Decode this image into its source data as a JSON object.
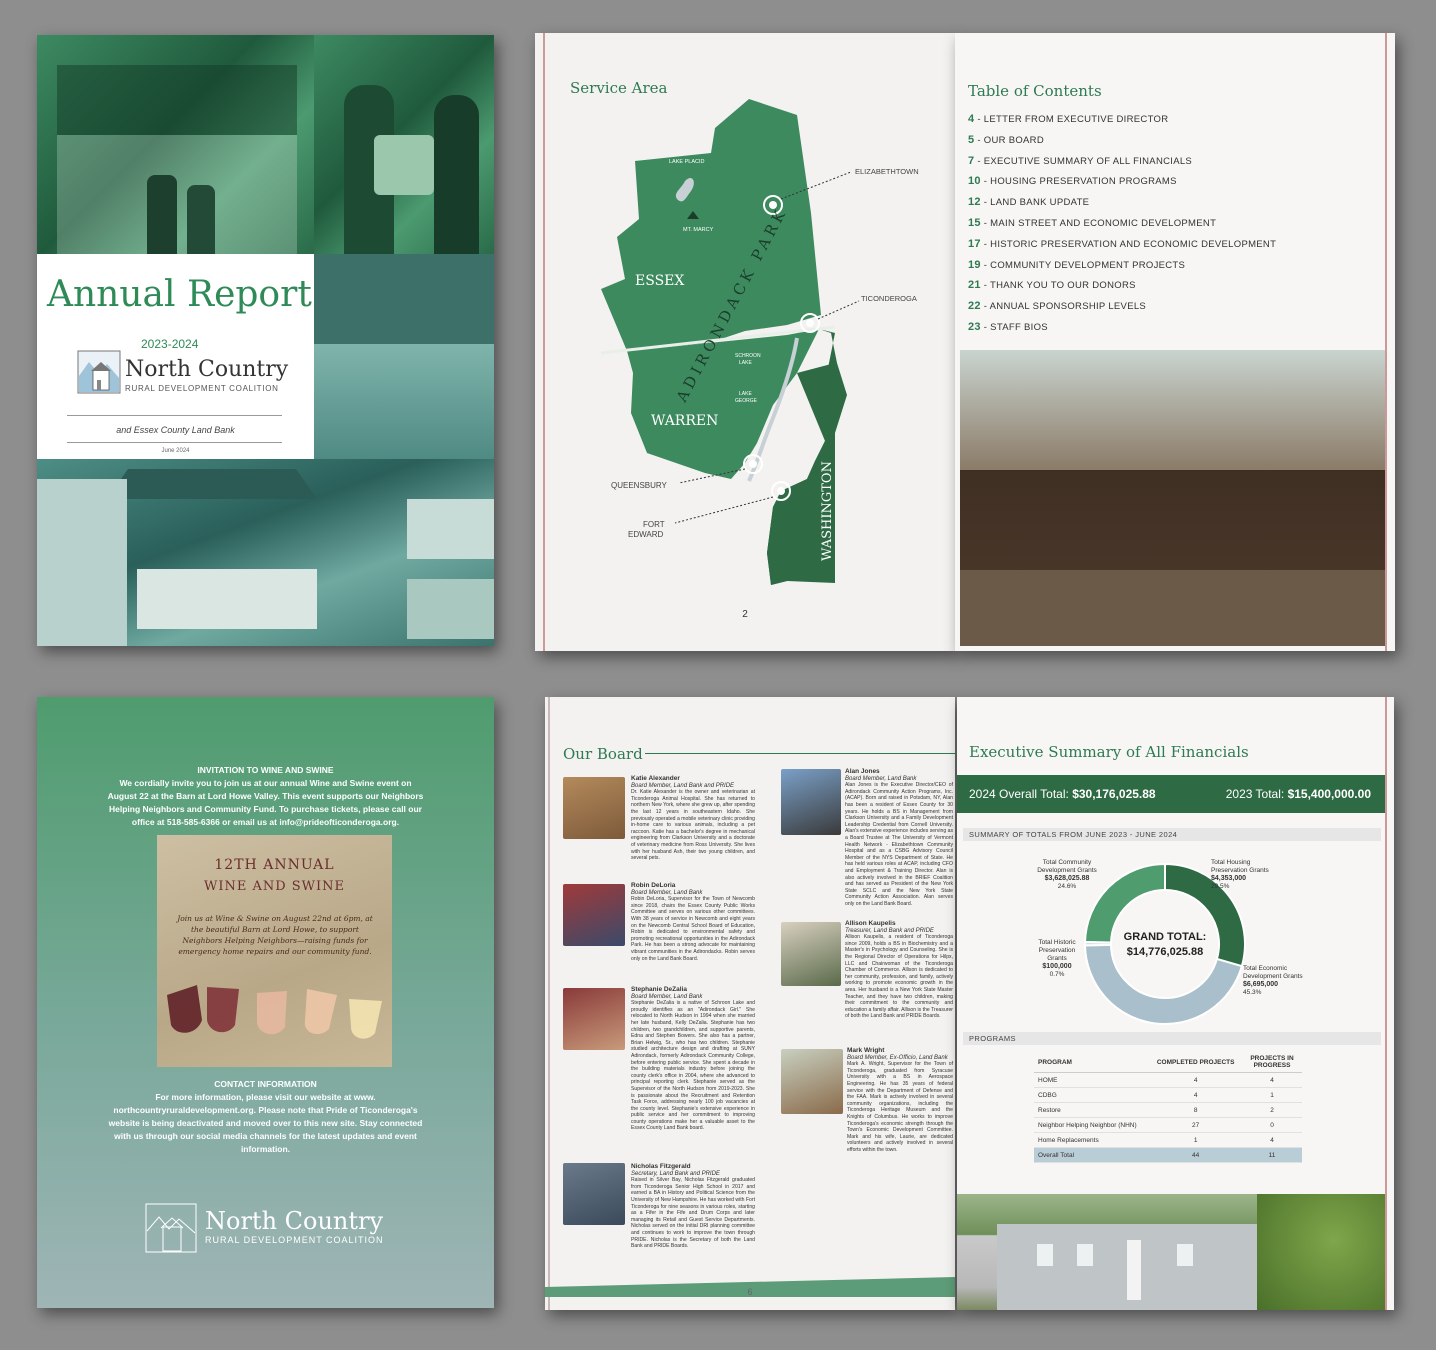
{
  "cover": {
    "title": "Annual Report",
    "years": "2023-2024",
    "org_name": "North Country",
    "org_sub": "RURAL DEVELOPMENT COALITION",
    "tagline": "and Essex County Land Bank",
    "date": "June 2024"
  },
  "map_page": {
    "title": "Service Area",
    "page_number": "2",
    "labels": {
      "lake_placid": "LAKE PLACID",
      "mt_marcy": "MT. MARCY",
      "adirondack_park": "ADIRONDACK PARK",
      "essex": "ESSEX",
      "warren": "WARREN",
      "washington": "WASHINGTON",
      "schroon_lake_1": "SCHROON",
      "schroon_lake_2": "LAKE",
      "lake_george_1": "LAKE",
      "lake_george_2": "GEORGE",
      "elizabethtown": "ELIZABETHTOWN",
      "ticonderoga": "TICONDEROGA",
      "queensbury": "QUEENSBURY",
      "fort_edward_1": "FORT",
      "fort_edward_2": "EDWARD"
    }
  },
  "toc": {
    "title": "Table of Contents",
    "items": [
      {
        "num": "4",
        "label": " - LETTER FROM EXECUTIVE DIRECTOR"
      },
      {
        "num": "5",
        "label": " - OUR BOARD"
      },
      {
        "num": "7",
        "label": " - EXECUTIVE SUMMARY OF ALL FINANCIALS"
      },
      {
        "num": "10",
        "label": " - HOUSING PRESERVATION PROGRAMS"
      },
      {
        "num": "12",
        "label": " - LAND BANK UPDATE"
      },
      {
        "num": "15",
        "label": " - MAIN STREET AND ECONOMIC DEVELOPMENT"
      },
      {
        "num": "17",
        "label": " - HISTORIC PRESERVATION AND ECONOMIC DEVELOPMENT"
      },
      {
        "num": "19",
        "label": " - COMMUNITY DEVELOPMENT PROJECTS"
      },
      {
        "num": "21",
        "label": " - THANK YOU TO OUR DONORS"
      },
      {
        "num": "22",
        "label": " - ANNUAL SPONSORSHIP LEVELS"
      },
      {
        "num": "23",
        "label": " - STAFF BIOS"
      }
    ]
  },
  "back_cover": {
    "invite_head": "INVITATION TO WINE AND SWINE",
    "invite_text": "We cordially invite you to join us at our annual Wine and Swine event on August 22 at the Barn at Lord Howe Valley. This event supports our Neighbors Helping Neighbors and Community Fund. To purchase tickets, please call our office at 518-585-6366 or email us at info@prideofticonderoga.org.",
    "card_line1": "12TH ANNUAL",
    "card_line2": "WINE AND SWINE",
    "card_text": "Join us at Wine & Swine on August 22nd at 6pm, at the beautiful Barn at Lord Howe, to support Neighbors Helping Neighbors—raising funds for emergency home repairs and our community fund.",
    "contact_head": "CONTACT INFORMATION",
    "contact_text": "For more information, please visit our website at www. northcountryruraldevelopment.org. Please note that Pride of Ticonderoga's website is being deactivated and moved over to this new site. Stay connected with us through our social media channels for the latest updates and event information.",
    "logo_name": "North Country",
    "logo_sub": "RURAL DEVELOPMENT COALITION"
  },
  "board": {
    "title": "Our Board",
    "page_number": "6",
    "members": [
      {
        "name": "Katie Alexander",
        "role": "Board Member, Land Bank and PRIDE",
        "bio": "Dr. Katie Alexander is the owner and veterinarian at Ticonderoga Animal Hospital. She has returned to northern New York, where she grew up, after spending the last 12 years in southeastern Idaho. She previously operated a mobile veterinary clinic providing in-home care to various animals, including a pet raccoon. Katie has a bachelor's degree in mechanical engineering from Clarkson University and a doctorate of veterinary medicine from Ross University. She lives with her husband Ash, their two young children, and several pets."
      },
      {
        "name": "Robin DeLoria",
        "role": "Board Member, Land Bank",
        "bio": "Robin DeLoria, Supervisor for the Town of Newcomb since 2018, chairs the Essex County Public Works Committee and serves on various other committees. With 38 years of service in Newcomb and eight years on the Newcomb Central School Board of Education, Robin is dedicated to environmental safety and promoting recreational opportunities in the Adirondack Park. He has been a strong advocate for maintaining vibrant communities in the Adirondacks. Robin serves only on the Land Bank Board."
      },
      {
        "name": "Stephanie DeZalia",
        "role": "Board Member, Land Bank",
        "bio": "Stephanie DeZalia is a native of Schroon Lake and proudly identifies as an \"Adirondack Girl.\" She relocated to North Hudson in 1994 when she married her late husband, Kelly DeZalia. Stephanie has two children, two grandchildren, and supportive parents, Edna and Stephen Bowers. She also has a partner, Brian Helwig, Sr., who has two children. Stephanie studied architecture design and drafting at SUNY Adirondack, formerly Adirondack Community College, before entering public service. She spent a decade in the building materials industry before joining the county clerk's office in 2004, where she advanced to principal reporting clerk. Stephanie served as the Supervisor of the North Hudson from 2019-2023. She is passionate about the Recruitment and Retention Task Force, addressing nearly 100 job vacancies at the county level. Stephanie's extensive experience in public service and her commitment to improving county operations make her a valuable asset to the Essex County Land Bank board."
      },
      {
        "name": "Nicholas Fitzgerald",
        "role": "Secretary, Land Bank and PRIDE",
        "bio": "Raised in Silver Bay, Nicholas Fitzgerald graduated from Ticonderoga Senior High School in 2017 and earned a BA in History and Political Science from the University of New Hampshire. He has worked with Fort Ticonderoga for nine seasons in various roles, starting as a Fifer in the Fife and Drum Corps and later managing its Retail and Guest Service Departments. Nicholas served on the initial DRI planning committee and continues to work to improve the town through PRIDE. Nicholas is the Secretary of both the Land Bank and PRIDE Boards."
      },
      {
        "name": "Alan Jones",
        "role": "Board Member, Land Bank",
        "bio": "Alan Jones is the Executive Director/CEO of Adirondack Community Action Programs, Inc. (ACAP). Born and raised in Potsdam, NY, Alan has been a resident of Essex County for 30 years. He holds a BS in Management from Clarkson University and a Family Development Leadership Credential from Cornell University. Alan's extensive experience includes serving as a Board Trustee at The University of Vermont Health Network - Elizabethtown Community Hospital and as a CSBG Advisory Council Member of the NYS Department of State. He has held various roles at ACAP, including CFO and Employment & Training Director. Alan is also actively involved in the BRIEF Coalition and has served as President of the New York State SCLC and the New York State Community Action Association. Alan serves only on the Land Bank Board."
      },
      {
        "name": "Allison Kaupelis",
        "role": "Treasurer, Land Bank and PRIDE",
        "bio": "Allison Kaupelis, a resident of Ticonderoga since 2009, holds a BS in Biochemistry and a Master's in Psychology and Counseling. She is the Regional Director of Operations for Hilpx, LLC and Chairwoman of the Ticonderoga Chamber of Commerce. Allison is dedicated to her community, profession, and family, actively working to promote economic growth in the area. Her husband is a New York State Master Teacher, and they have two children, making their commitment to the community and education a family affair. Allison is the Treasurer of both the Land Bank and PRIDE Boards."
      },
      {
        "name": "Mark Wright",
        "role": "Board Member, Ex-Officio, Land Bank",
        "bio": "Mark A. Wright, Supervisor for the Town of Ticonderoga, graduated from Syracuse University with a BS in Aerospace Engineering. He has 35 years of federal service with the Department of Defense and the FAA. Mark is actively involved in several community organizations, including the Ticonderoga Heritage Museum and the Knights of Columbus. He works to improve Ticonderoga's economic strength through the Town's Economic Development Committee. Mark and his wife, Laurie, are dedicated volunteers and actively involved in several efforts within the town."
      }
    ]
  },
  "financials": {
    "title": "Executive Summary of All Financials",
    "total_2024_label": "2024 Overall Total:",
    "total_2024_value": "$30,176,025.88",
    "total_2023_label": "2023 Total:",
    "total_2023_value": "$15,400,000.00",
    "summary_head": "SUMMARY OF TOTALS FROM JUNE 2023 - JUNE 2024",
    "grand_total_label": "GRAND TOTAL:",
    "grand_total_value": "$14,776,025.88",
    "donut": [
      {
        "label1": "Total Community",
        "label2": "Development Grants",
        "amount": "$3,628,025.88",
        "percent": "24.6%",
        "share": 24.6,
        "color": "#4f9c6e"
      },
      {
        "label1": "Total Housing",
        "label2": "Preservation Grants",
        "amount": "$4,353,000",
        "percent": "29.5%",
        "share": 29.5,
        "color": "#2e6b45"
      },
      {
        "label1": "Total Economic",
        "label2": "Development Grants",
        "amount": "$6,695,000",
        "percent": "45.3%",
        "share": 45.3,
        "color": "#a9bfcb"
      },
      {
        "label1": "Total Historic Preservation",
        "label2": "Grants",
        "amount": "$100,000",
        "percent": "0.7%",
        "share": 0.7,
        "color": "#d6e0e6"
      }
    ],
    "programs_head": "PROGRAMS",
    "table_headers": [
      "PROGRAM",
      "COMPLETED PROJECTS",
      "PROJECTS IN PROGRESS"
    ],
    "table_rows": [
      [
        "HOME",
        "4",
        "4"
      ],
      [
        "CDBG",
        "4",
        "1"
      ],
      [
        "Restore",
        "8",
        "2"
      ],
      [
        "Neighbor Helping Neighbor (NHN)",
        "27",
        "0"
      ],
      [
        "Home Replacements",
        "1",
        "4"
      ],
      [
        "Overall Total",
        "44",
        "11"
      ]
    ]
  }
}
